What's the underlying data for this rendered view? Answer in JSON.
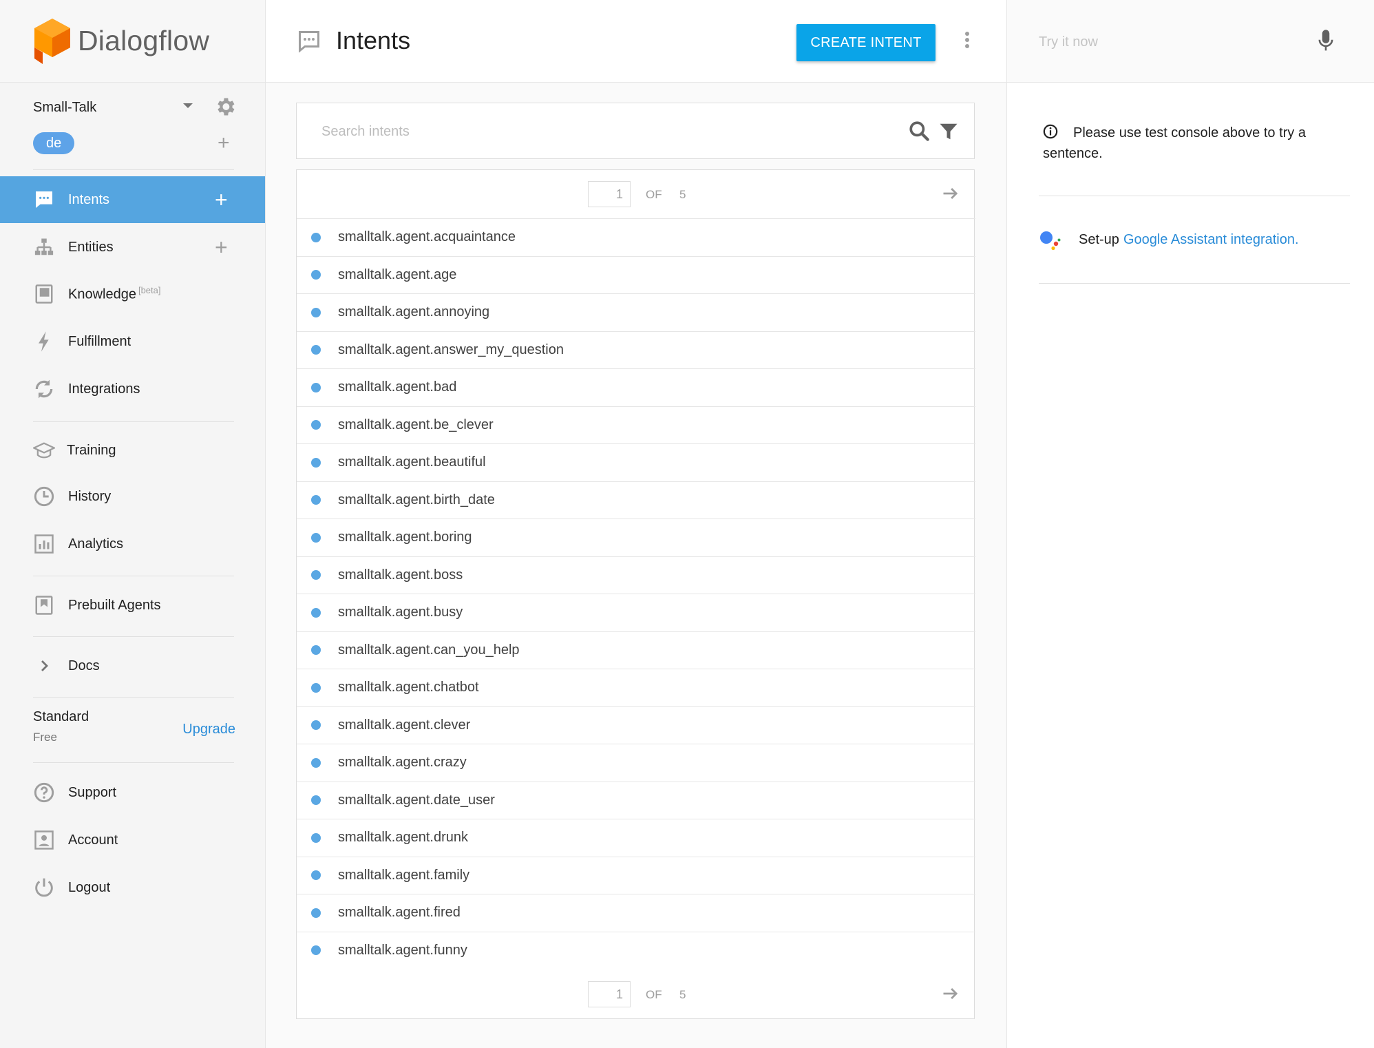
{
  "brand": {
    "name": "Dialogflow"
  },
  "agent": {
    "name": "Small-Talk",
    "language": "de"
  },
  "sidebar": {
    "items": [
      {
        "id": "intents",
        "label": "Intents",
        "active": true,
        "has_plus": true
      },
      {
        "id": "entities",
        "label": "Entities",
        "has_plus": true
      },
      {
        "id": "knowledge",
        "label": "Knowledge",
        "badge": "[beta]"
      },
      {
        "id": "fulfillment",
        "label": "Fulfillment"
      },
      {
        "id": "integrations",
        "label": "Integrations"
      },
      {
        "id": "training",
        "label": "Training"
      },
      {
        "id": "history",
        "label": "History"
      },
      {
        "id": "analytics",
        "label": "Analytics"
      },
      {
        "id": "prebuilt",
        "label": "Prebuilt Agents"
      },
      {
        "id": "docs",
        "label": "Docs"
      },
      {
        "id": "support",
        "label": "Support"
      },
      {
        "id": "account",
        "label": "Account"
      },
      {
        "id": "logout",
        "label": "Logout"
      }
    ],
    "plan": {
      "name": "Standard",
      "tier": "Free",
      "upgrade_label": "Upgrade"
    }
  },
  "main": {
    "title": "Intents",
    "create_button": "CREATE INTENT",
    "search": {
      "placeholder": "Search intents"
    },
    "pagination": {
      "current": "1",
      "of_label": "OF",
      "total": "5"
    },
    "intents": [
      "smalltalk.agent.acquaintance",
      "smalltalk.agent.age",
      "smalltalk.agent.annoying",
      "smalltalk.agent.answer_my_question",
      "smalltalk.agent.bad",
      "smalltalk.agent.be_clever",
      "smalltalk.agent.beautiful",
      "smalltalk.agent.birth_date",
      "smalltalk.agent.boring",
      "smalltalk.agent.boss",
      "smalltalk.agent.busy",
      "smalltalk.agent.can_you_help",
      "smalltalk.agent.chatbot",
      "smalltalk.agent.clever",
      "smalltalk.agent.crazy",
      "smalltalk.agent.date_user",
      "smalltalk.agent.drunk",
      "smalltalk.agent.family",
      "smalltalk.agent.fired",
      "smalltalk.agent.funny"
    ]
  },
  "right_panel": {
    "try_placeholder": "Try it now",
    "info_text": "Please use test console above to try a sentence.",
    "ga_prefix": "Set-up",
    "ga_link": "Google Assistant integration."
  },
  "colors": {
    "accent": "#0aa4e8",
    "active_nav": "#55a5e0",
    "dot": "#5aa7e3",
    "link": "#2a8cd8"
  }
}
